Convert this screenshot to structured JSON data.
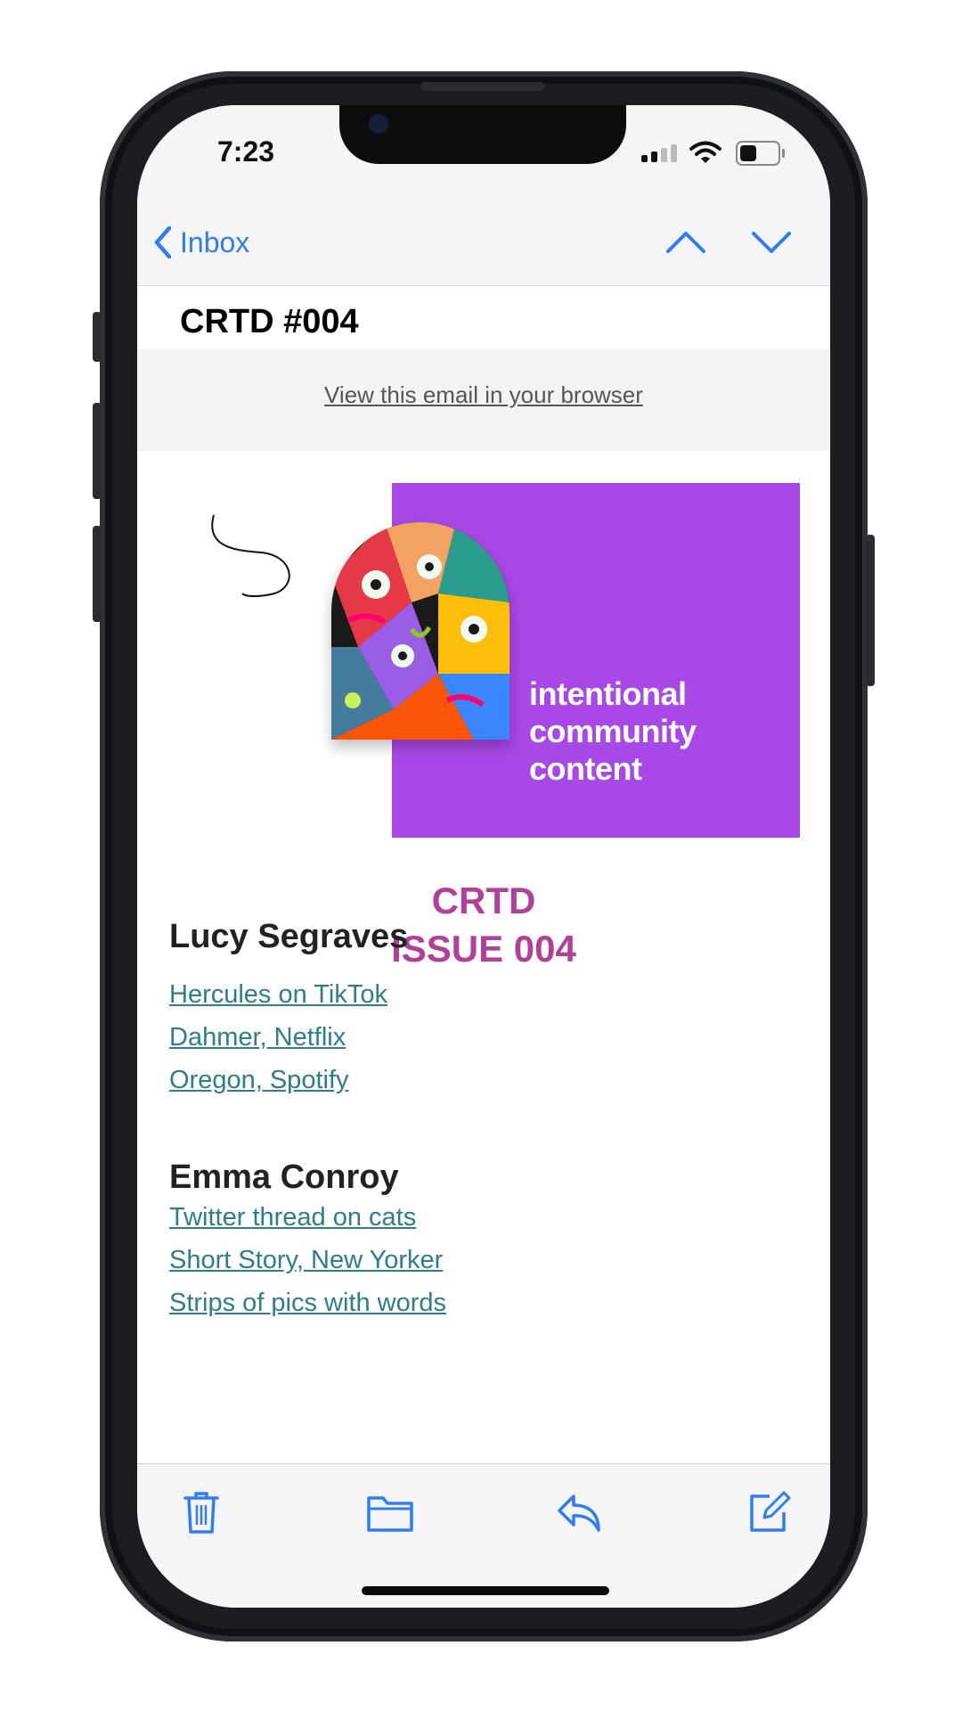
{
  "status_bar": {
    "time": "7:23"
  },
  "nav": {
    "back_label": "Inbox"
  },
  "email": {
    "subject": "CRTD #004",
    "browser_link": "View this email in your browser",
    "hero_text": [
      "intentional",
      "community",
      "content"
    ],
    "issue_title": "CRTD",
    "issue_number": "ISSUE 004",
    "sections": [
      {
        "author": "Lucy Segraves",
        "links": [
          "Hercules on TikTok",
          "Dahmer, Netflix",
          "Oregon, Spotify"
        ]
      },
      {
        "author": "Emma Conroy",
        "links": [
          "Twitter thread on cats",
          "Short Story, New Yorker",
          "Strips of pics with words "
        ]
      }
    ]
  },
  "colors": {
    "accent_blue": "#2f7cf6",
    "hero_purple": "#a848e6",
    "issue_magenta": "#b0409a",
    "link_teal": "#2d7d8a"
  },
  "icons": [
    "chevron-left-icon",
    "chevron-up-icon",
    "chevron-down-icon",
    "trash-icon",
    "folder-icon",
    "reply-icon",
    "compose-icon"
  ]
}
